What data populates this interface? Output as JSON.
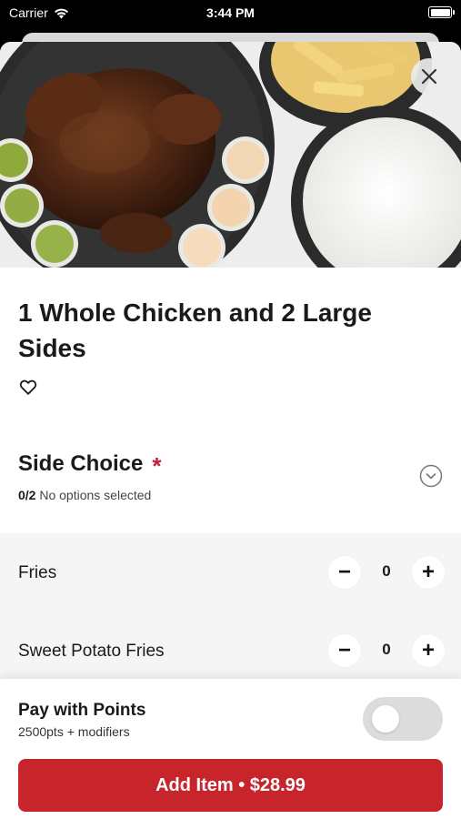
{
  "status_bar": {
    "carrier": "Carrier",
    "time": "3:44 PM",
    "icons": [
      "wifi-icon",
      "battery-icon"
    ]
  },
  "hero": {
    "image": "food-photo",
    "close_icon": "close-icon"
  },
  "item": {
    "title": "1 Whole Chicken and 2 Large Sides",
    "favorite_icon": "heart-icon"
  },
  "side_choice": {
    "title": "Side Choice",
    "required_marker": "*",
    "count": "0/2",
    "status": "No options selected",
    "chevron_icon": "chevron-down-circle-icon"
  },
  "options": [
    {
      "label": "Fries",
      "quantity": "0",
      "minus": "−",
      "plus": "+"
    },
    {
      "label": "Sweet Potato Fries",
      "quantity": "0",
      "minus": "−",
      "plus": "+"
    }
  ],
  "points": {
    "title": "Pay with Points",
    "subtitle": "2500pts + modifiers",
    "toggle_on": false
  },
  "add_button": {
    "label": "Add Item • $28.99"
  },
  "colors": {
    "accent": "#c7252b",
    "required": "#c41e3a",
    "option_bg": "#f5f5f5",
    "toggle_off": "#dcdcdc"
  }
}
